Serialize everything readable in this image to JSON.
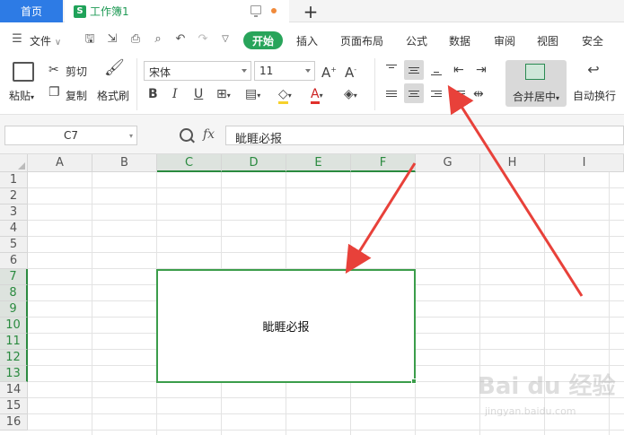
{
  "tabs": {
    "home": "首页",
    "workbook": "工作簿1",
    "workbook_logo": "S"
  },
  "menu": {
    "file": "文件",
    "items": [
      "开始",
      "插入",
      "页面布局",
      "公式",
      "数据",
      "审阅",
      "视图",
      "安全"
    ]
  },
  "ribbon": {
    "paste": "粘贴",
    "cut": "剪切",
    "copy": "复制",
    "format_painter": "格式刷",
    "font_name": "宋体",
    "font_size": "11",
    "merge_center": "合并居中",
    "wrap_text": "自动换行"
  },
  "formula": {
    "name_box": "C7",
    "fx": "fx",
    "value": "眦睚必报"
  },
  "grid": {
    "columns": [
      "A",
      "B",
      "C",
      "D",
      "E",
      "F",
      "G",
      "H",
      "I"
    ],
    "selected_columns": [
      "C",
      "D",
      "E",
      "F"
    ],
    "rows": [
      "1",
      "2",
      "3",
      "4",
      "5",
      "6",
      "7",
      "8",
      "9",
      "10",
      "11",
      "12",
      "13",
      "14",
      "15",
      "16"
    ],
    "selected_rows": [
      "7",
      "8",
      "9",
      "10",
      "11",
      "12",
      "13"
    ],
    "merged_cell_text": "眦睚必报"
  },
  "watermark": {
    "main": "Bai du 经验",
    "sub": "jingyan.baidu.com"
  },
  "colors": {
    "accent_green": "#28a45a",
    "home_tab": "#2d7be5",
    "arrow": "#e8413a"
  }
}
